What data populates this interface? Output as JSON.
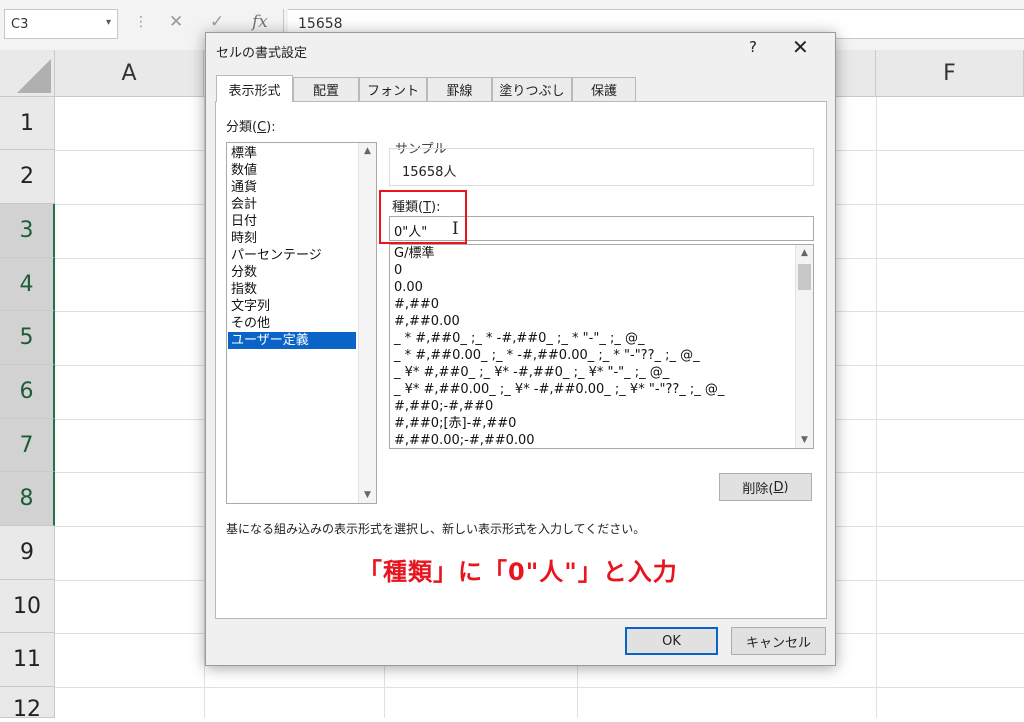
{
  "formula_bar": {
    "name_box": "C3",
    "name_box_arrow": "▾",
    "dots": "⋮",
    "cancel_glyph": "✕",
    "enter_glyph": "✓",
    "fx_label": "fx",
    "value": "15658"
  },
  "grid": {
    "columns": [
      "A",
      "F"
    ],
    "rows": [
      "1",
      "2",
      "3",
      "4",
      "5",
      "6",
      "7",
      "8",
      "9",
      "10",
      "11",
      "12"
    ],
    "selected_rows": [
      "3",
      "4",
      "5",
      "6",
      "7",
      "8"
    ]
  },
  "dialog": {
    "title": "セルの書式設定",
    "help_glyph": "?",
    "close_glyph": "✕",
    "tabs": [
      {
        "label": "表示形式",
        "active": true
      },
      {
        "label": "配置",
        "active": false
      },
      {
        "label": "フォント",
        "active": false
      },
      {
        "label": "罫線",
        "active": false
      },
      {
        "label": "塗りつぶし",
        "active": false
      },
      {
        "label": "保護",
        "active": false
      }
    ],
    "category_label_pre": "分類(",
    "category_label_key": "C",
    "category_label_post": "):",
    "categories": [
      "標準",
      "数値",
      "通貨",
      "会計",
      "日付",
      "時刻",
      "パーセンテージ",
      "分数",
      "指数",
      "文字列",
      "その他",
      "ユーザー定義"
    ],
    "selected_category": "ユーザー定義",
    "sample_label": "サンプル",
    "sample_value": "15658人",
    "type_label_pre": "種類(",
    "type_label_key": "T",
    "type_label_post": "):",
    "type_value": "0\"人\"",
    "formats": [
      "G/標準",
      "0",
      "0.00",
      "#,##0",
      "#,##0.00",
      "_ * #,##0_ ;_ * -#,##0_ ;_ * \"-\"_ ;_ @_",
      "_ * #,##0.00_ ;_ * -#,##0.00_ ;_ * \"-\"??_ ;_ @_",
      "_ ¥* #,##0_ ;_ ¥* -#,##0_ ;_ ¥* \"-\"_ ;_ @_",
      "_ ¥* #,##0.00_ ;_ ¥* -#,##0.00_ ;_ ¥* \"-\"??_ ;_ @_",
      "#,##0;-#,##0",
      "#,##0;[赤]-#,##0",
      "#,##0.00;-#,##0.00"
    ],
    "delete_button_pre": "削除(",
    "delete_button_key": "D",
    "delete_button_post": ")",
    "description": "基になる組み込みの表示形式を選択し、新しい表示形式を入力してください。",
    "annotation": "「種類」に「0\"人\"」と入力",
    "ok_label": "OK",
    "cancel_label": "キャンセル"
  },
  "colors": {
    "selection_blue": "#0a64c8",
    "annotation_red": "#e8141e",
    "excel_green": "#217346"
  }
}
